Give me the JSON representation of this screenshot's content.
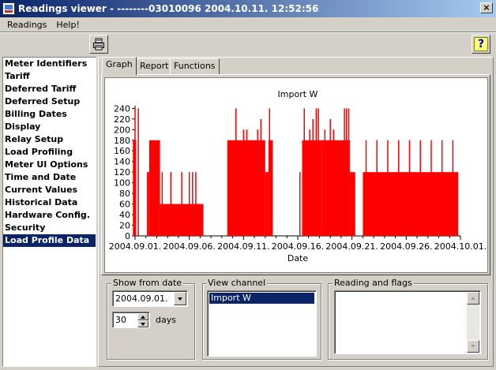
{
  "window": {
    "title": "Readings viewer - --------03010096 2004.10.11. 12:52:56",
    "close_glyph": "×"
  },
  "menu": {
    "items": [
      "Readings",
      "Help!"
    ]
  },
  "toolbar": {
    "help_glyph": "?"
  },
  "nav": {
    "items": [
      "Meter Identifiers",
      "Tariff",
      "Deferred Tariff",
      "Deferred Setup",
      "Billing Dates",
      "Display",
      "Relay Setup",
      "Load Profiling",
      "Meter UI Options",
      "Time and Date",
      "Current Values",
      "Historical Data",
      "Hardware Config.",
      "Security",
      "Load Profile Data"
    ],
    "selected": "Load Profile Data"
  },
  "tabs": {
    "items": [
      "Graph",
      "Report",
      "Functions"
    ],
    "active": "Graph"
  },
  "chart_data": {
    "type": "bar",
    "title": "Import W",
    "xlabel": "Date",
    "ylabel": "",
    "ylim": [
      0,
      245
    ],
    "y_ticks": [
      0,
      20,
      40,
      60,
      80,
      100,
      120,
      140,
      160,
      180,
      200,
      220,
      240
    ],
    "x_ticks": [
      "2004.09.01.",
      "2004.09.06.",
      "2004.09.11.",
      "2004.09.16.",
      "2004.09.21.",
      "2004.09.26.",
      "2004.10.01."
    ],
    "xlim_days": [
      0,
      30
    ],
    "color": "#ff0000",
    "series": [
      {
        "segments": [
          {
            "from_day": -0.2,
            "to_day": 0.1,
            "value": 180
          },
          {
            "from_day": 1.1,
            "to_day": 1.3,
            "value": 120
          },
          {
            "from_day": 1.3,
            "to_day": 2.3,
            "value": 180
          },
          {
            "from_day": 2.3,
            "to_day": 6.3,
            "value": 60
          },
          {
            "from_day": 8.5,
            "to_day": 12.0,
            "value": 180
          },
          {
            "from_day": 12.0,
            "to_day": 12.3,
            "value": 120
          },
          {
            "from_day": 12.3,
            "to_day": 12.7,
            "value": 180
          },
          {
            "from_day": 15.4,
            "to_day": 17.2,
            "value": 180
          },
          {
            "from_day": 17.2,
            "to_day": 19.8,
            "value": 180
          },
          {
            "from_day": 19.8,
            "to_day": 20.3,
            "value": 120
          },
          {
            "from_day": 21.0,
            "to_day": 29.8,
            "value": 120
          }
        ],
        "spikes": [
          {
            "day": 0.0,
            "value": 240
          },
          {
            "day": 0.3,
            "value": 240
          },
          {
            "day": 1.5,
            "value": 180
          },
          {
            "day": 2.0,
            "value": 120
          },
          {
            "day": 2.5,
            "value": 120
          },
          {
            "day": 3.3,
            "value": 120
          },
          {
            "day": 4.3,
            "value": 120
          },
          {
            "day": 5.0,
            "value": 120
          },
          {
            "day": 5.3,
            "value": 120
          },
          {
            "day": 5.6,
            "value": 120
          },
          {
            "day": 9.3,
            "value": 240
          },
          {
            "day": 10.0,
            "value": 200
          },
          {
            "day": 10.3,
            "value": 200
          },
          {
            "day": 11.3,
            "value": 200
          },
          {
            "day": 11.6,
            "value": 220
          },
          {
            "day": 12.4,
            "value": 240
          },
          {
            "day": 15.2,
            "value": 120
          },
          {
            "day": 15.6,
            "value": 240
          },
          {
            "day": 16.1,
            "value": 200
          },
          {
            "day": 16.4,
            "value": 220
          },
          {
            "day": 16.7,
            "value": 240
          },
          {
            "day": 16.9,
            "value": 240
          },
          {
            "day": 17.5,
            "value": 200
          },
          {
            "day": 18.0,
            "value": 220
          },
          {
            "day": 18.3,
            "value": 200
          },
          {
            "day": 19.3,
            "value": 240
          },
          {
            "day": 19.5,
            "value": 240
          },
          {
            "day": 19.7,
            "value": 240
          },
          {
            "day": 21.3,
            "value": 180
          },
          {
            "day": 22.3,
            "value": 180
          },
          {
            "day": 23.3,
            "value": 180
          },
          {
            "day": 24.3,
            "value": 180
          },
          {
            "day": 25.3,
            "value": 180
          },
          {
            "day": 26.3,
            "value": 180
          },
          {
            "day": 27.3,
            "value": 180
          },
          {
            "day": 28.3,
            "value": 180
          },
          {
            "day": 29.3,
            "value": 180
          }
        ]
      }
    ]
  },
  "show_from": {
    "label": "Show from date",
    "date": "2004.09.01.",
    "days_value": "30",
    "days_label": "days"
  },
  "view_channel": {
    "label": "View channel",
    "items": [
      "Import W"
    ],
    "selected": "Import W"
  },
  "reading_flags": {
    "label": "Reading and flags"
  }
}
